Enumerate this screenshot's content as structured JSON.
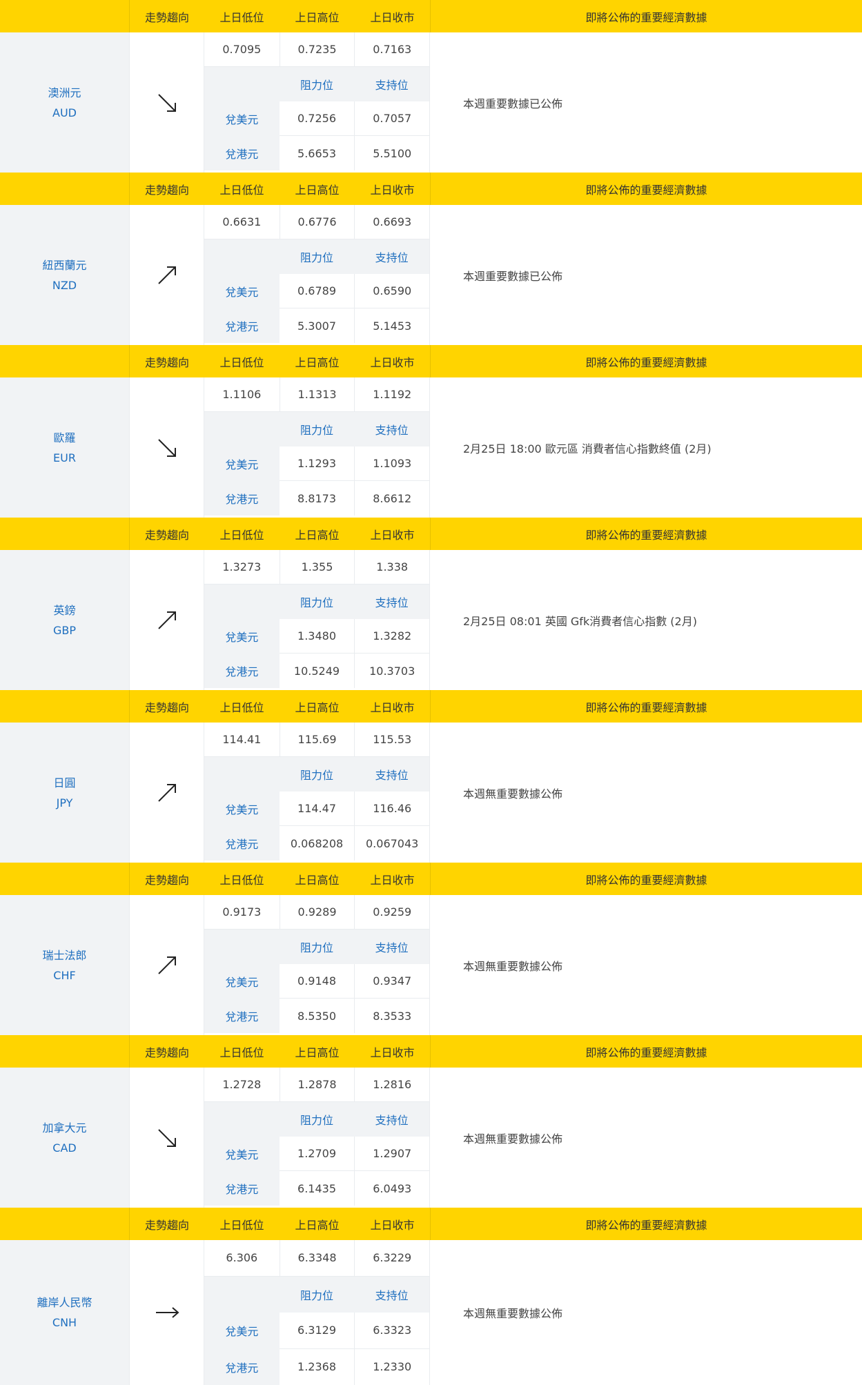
{
  "headers": {
    "trend": "走勢趨向",
    "prev_low": "上日低位",
    "prev_high": "上日高位",
    "prev_close": "上日收市",
    "news": "即將公佈的重要經濟數據"
  },
  "sub_headers": {
    "resistance": "阻力位",
    "support": "支持位"
  },
  "row_labels": {
    "usd": "兌美元",
    "hkd": "兌港元"
  },
  "colors": {
    "header_bg": "#ffd400",
    "link_blue": "#1f6fbf",
    "panel_gray": "#f1f3f5"
  },
  "currencies": [
    {
      "name": "澳洲元",
      "code": "AUD",
      "trend": "down-right-arrow-icon",
      "prev_low": "0.7095",
      "prev_high": "0.7235",
      "prev_close": "0.7163",
      "usd_res": "0.7256",
      "usd_sup": "0.7057",
      "hkd_res": "5.6653",
      "hkd_sup": "5.5100",
      "news": "本週重要數據已公佈"
    },
    {
      "name": "紐西蘭元",
      "code": "NZD",
      "trend": "up-right-arrow-icon",
      "prev_low": "0.6631",
      "prev_high": "0.6776",
      "prev_close": "0.6693",
      "usd_res": "0.6789",
      "usd_sup": "0.6590",
      "hkd_res": "5.3007",
      "hkd_sup": "5.1453",
      "news": "本週重要數據已公佈"
    },
    {
      "name": "歐羅",
      "code": "EUR",
      "trend": "down-right-arrow-icon",
      "prev_low": "1.1106",
      "prev_high": "1.1313",
      "prev_close": "1.1192",
      "usd_res": "1.1293",
      "usd_sup": "1.1093",
      "hkd_res": "8.8173",
      "hkd_sup": "8.6612",
      "news": "2月25日 18:00  歐元區 消費者信心指數終值 (2月)"
    },
    {
      "name": "英鎊",
      "code": "GBP",
      "trend": "up-right-arrow-icon",
      "prev_low": "1.3273",
      "prev_high": "1.355",
      "prev_close": "1.338",
      "usd_res": "1.3480",
      "usd_sup": "1.3282",
      "hkd_res": "10.5249",
      "hkd_sup": "10.3703",
      "news": "2月25日 08:01  英國 Gfk消費者信心指數 (2月)"
    },
    {
      "name": "日圓",
      "code": "JPY",
      "trend": "up-right-arrow-icon",
      "prev_low": "114.41",
      "prev_high": "115.69",
      "prev_close": "115.53",
      "usd_res": "114.47",
      "usd_sup": "116.46",
      "hkd_res": "0.068208",
      "hkd_sup": "0.067043",
      "news": "本週無重要數據公佈"
    },
    {
      "name": "瑞士法郎",
      "code": "CHF",
      "trend": "up-right-arrow-icon",
      "prev_low": "0.9173",
      "prev_high": "0.9289",
      "prev_close": "0.9259",
      "usd_res": "0.9148",
      "usd_sup": "0.9347",
      "hkd_res": "8.5350",
      "hkd_sup": "8.3533",
      "news": "本週無重要數據公佈"
    },
    {
      "name": "加拿大元",
      "code": "CAD",
      "trend": "down-right-arrow-icon",
      "prev_low": "1.2728",
      "prev_high": "1.2878",
      "prev_close": "1.2816",
      "usd_res": "1.2709",
      "usd_sup": "1.2907",
      "hkd_res": "6.1435",
      "hkd_sup": "6.0493",
      "news": "本週無重要數據公佈"
    },
    {
      "name": "離岸人民幣",
      "code": "CNH",
      "trend": "right-arrow-icon",
      "prev_low": "6.306",
      "prev_high": "6.3348",
      "prev_close": "6.3229",
      "usd_res": "6.3129",
      "usd_sup": "6.3323",
      "hkd_res": "1.2368",
      "hkd_sup": "1.2330",
      "news": "本週無重要數據公佈"
    }
  ]
}
